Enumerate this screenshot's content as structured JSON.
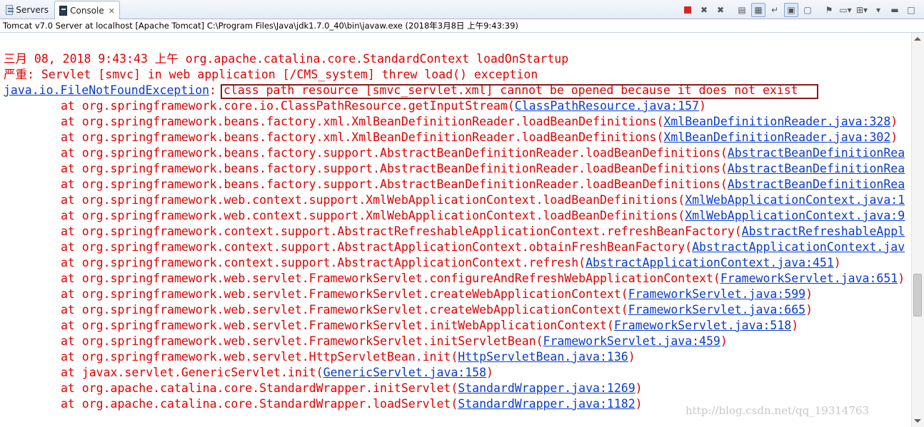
{
  "tabs": {
    "servers_label": "Servers",
    "console_label": "Console",
    "console_close": "✕"
  },
  "toolbar": {
    "icons": [
      "terminate-icon",
      "remove-launch-icon",
      "remove-all-icon",
      "clear-console-icon",
      "scroll-lock-icon",
      "word-wrap-icon",
      "show-on-output-icon",
      "show-on-error-icon",
      "pin-console-icon",
      "display-console-icon",
      "open-console-icon",
      "view-menu-icon",
      "minimize-icon",
      "maximize-icon"
    ]
  },
  "colors": {
    "error_text": "#e00000",
    "link_text": "#0a3cc8",
    "highlight_border": "#8b1a1a"
  },
  "info": "Tomcat v7.0 Server at localhost [Apache Tomcat] C:\\Program Files\\Java\\jdk1.7.0_40\\bin\\javaw.exe (2018年3月8日 上午9:43:39)",
  "console": {
    "l1": "三月 08, 2018 9:43:43 上午 org.apache.catalina.core.StandardContext loadOnStartup",
    "l2": "严重: Servlet [smvc] in web application [/CMS_system] threw load() exception",
    "l3_link": "java.io.FileNotFoundException",
    "l3_sep": ": ",
    "l3_msg": "class path resource [smvc_servlet.xml] cannot be opened because it does not exist",
    "frames": [
      {
        "text": "at org.springframework.core.io.ClassPathResource.getInputStream(",
        "link": "ClassPathResource.java:157",
        "tail": ")"
      },
      {
        "text": "at org.springframework.beans.factory.xml.XmlBeanDefinitionReader.loadBeanDefinitions(",
        "link": "XmlBeanDefinitionReader.java:328",
        "tail": ")"
      },
      {
        "text": "at org.springframework.beans.factory.xml.XmlBeanDefinitionReader.loadBeanDefinitions(",
        "link": "XmlBeanDefinitionReader.java:302",
        "tail": ")"
      },
      {
        "text": "at org.springframework.beans.factory.support.AbstractBeanDefinitionReader.loadBeanDefinitions(",
        "link": "AbstractBeanDefinitionRea",
        "tail": ""
      },
      {
        "text": "at org.springframework.beans.factory.support.AbstractBeanDefinitionReader.loadBeanDefinitions(",
        "link": "AbstractBeanDefinitionRea",
        "tail": ""
      },
      {
        "text": "at org.springframework.beans.factory.support.AbstractBeanDefinitionReader.loadBeanDefinitions(",
        "link": "AbstractBeanDefinitionRea",
        "tail": ""
      },
      {
        "text": "at org.springframework.web.context.support.XmlWebApplicationContext.loadBeanDefinitions(",
        "link": "XmlWebApplicationContext.java:1",
        "tail": ""
      },
      {
        "text": "at org.springframework.web.context.support.XmlWebApplicationContext.loadBeanDefinitions(",
        "link": "XmlWebApplicationContext.java:9",
        "tail": ""
      },
      {
        "text": "at org.springframework.context.support.AbstractRefreshableApplicationContext.refreshBeanFactory(",
        "link": "AbstractRefreshableAppl",
        "tail": ""
      },
      {
        "text": "at org.springframework.context.support.AbstractApplicationContext.obtainFreshBeanFactory(",
        "link": "AbstractApplicationContext.jav",
        "tail": ""
      },
      {
        "text": "at org.springframework.context.support.AbstractApplicationContext.refresh(",
        "link": "AbstractApplicationContext.java:451",
        "tail": ")"
      },
      {
        "text": "at org.springframework.web.servlet.FrameworkServlet.configureAndRefreshWebApplicationContext(",
        "link": "FrameworkServlet.java:651",
        "tail": ")"
      },
      {
        "text": "at org.springframework.web.servlet.FrameworkServlet.createWebApplicationContext(",
        "link": "FrameworkServlet.java:599",
        "tail": ")"
      },
      {
        "text": "at org.springframework.web.servlet.FrameworkServlet.createWebApplicationContext(",
        "link": "FrameworkServlet.java:665",
        "tail": ")"
      },
      {
        "text": "at org.springframework.web.servlet.FrameworkServlet.initWebApplicationContext(",
        "link": "FrameworkServlet.java:518",
        "tail": ")"
      },
      {
        "text": "at org.springframework.web.servlet.FrameworkServlet.initServletBean(",
        "link": "FrameworkServlet.java:459",
        "tail": ")"
      },
      {
        "text": "at org.springframework.web.servlet.HttpServletBean.init(",
        "link": "HttpServletBean.java:136",
        "tail": ")"
      },
      {
        "text": "at javax.servlet.GenericServlet.init(",
        "link": "GenericServlet.java:158",
        "tail": ")"
      },
      {
        "text": "at org.apache.catalina.core.StandardWrapper.initServlet(",
        "link": "StandardWrapper.java:1269",
        "tail": ")"
      },
      {
        "text": "at org.apache.catalina.core.StandardWrapper.loadServlet(",
        "link": "StandardWrapper.java:1182",
        "tail": ")"
      }
    ]
  },
  "watermark": "http://blog.csdn.net/qq_19314763"
}
